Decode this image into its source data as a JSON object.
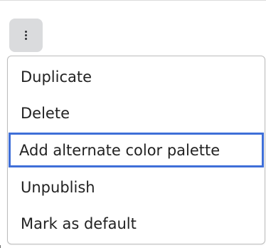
{
  "kebab_button": {
    "icon": "vertical-dots-icon"
  },
  "menu": {
    "items": [
      {
        "label": "Duplicate",
        "focused": false
      },
      {
        "label": "Delete",
        "focused": false
      },
      {
        "label": "Add alternate color palette",
        "focused": true
      },
      {
        "label": "Unpublish",
        "focused": false
      },
      {
        "label": "Mark as default",
        "focused": false
      }
    ]
  },
  "colors": {
    "focus_ring": "#3f6fd8",
    "button_bg": "#dadbdd",
    "text": "#222222",
    "menu_border": "#bcbcbc"
  }
}
